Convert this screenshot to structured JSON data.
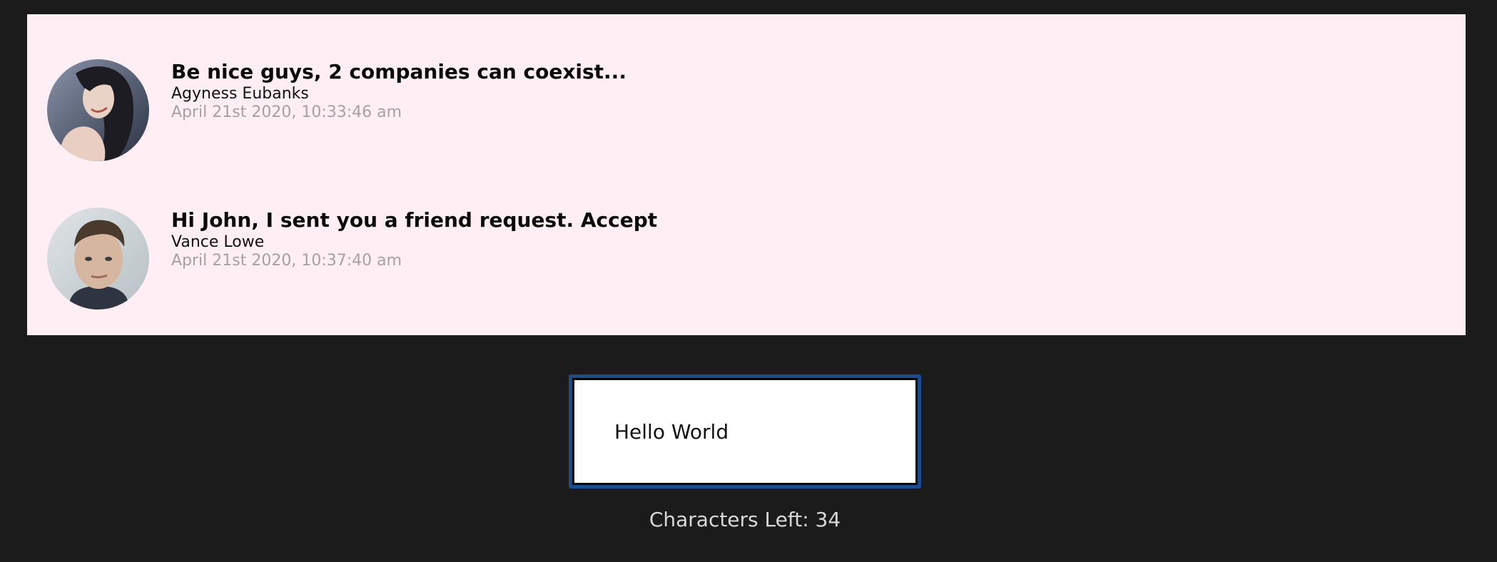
{
  "messages": [
    {
      "title": "Be nice guys, 2 companies can coexist...",
      "author": "Agyness Eubanks",
      "timestamp": "April 21st 2020, 10:33:46 am",
      "avatar_icon": "user-avatar-photo"
    },
    {
      "title": "Hi John, I sent you a friend request. Accept",
      "author": "Vance Lowe",
      "timestamp": "April 21st 2020, 10:37:40 am",
      "avatar_icon": "user-avatar-photo"
    }
  ],
  "composer": {
    "value": "Hello World",
    "chars_left_text": "Characters Left: 34"
  },
  "colors": {
    "page_background": "#1b1b1b",
    "feed_background": "#ffeff4",
    "focus_ring": "#1d4c8e",
    "timestamp": "#a7a0a3",
    "chars_left": "#d8d8d8"
  }
}
